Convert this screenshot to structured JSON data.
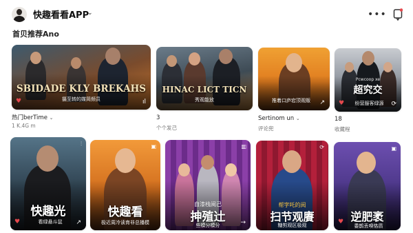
{
  "header": {
    "app_title": "快趣看看APP",
    "title_chevron": "⌄",
    "more": "•••"
  },
  "section": {
    "title": "首贝推荐Ano"
  },
  "row1": [
    {
      "title": "SBIDADE KLY BREKAHS",
      "subtitle": "摄至转的媒简频员",
      "meta1": "热门berTime",
      "meta2": "1 K.4G m"
    },
    {
      "title": "HINAC LICT TICN",
      "subtitle": "秀观能放",
      "meta1": "3",
      "meta2": "个个发己"
    },
    {
      "title": "",
      "subtitle": "推着口庐宕顶观贩",
      "meta1": "Sertinom un",
      "meta2": "评论兜"
    },
    {
      "title": "超究交",
      "subtitle": "纷营服客绿源",
      "tag": "Pcwcoop xe",
      "meta1": "18",
      "meta2": "收藏程"
    }
  ],
  "row2": [
    {
      "title": "快趣光",
      "subtitle": "看绿悬斗鼠"
    },
    {
      "title": "快趣看",
      "subtitle": "极近周冷读育非总播模"
    },
    {
      "title": "抻殖辻",
      "caption": "自漆栈阅己",
      "subtitle": "些模分模分"
    },
    {
      "title": "扫节观賡",
      "caption": "帮字吒的阅",
      "subtitle": "糖剪观区极观"
    },
    {
      "title": "逆肥袤",
      "subtitle": "委鹊丢嗅恪质"
    }
  ],
  "colors": {
    "accent": "#e5484d",
    "poster_title": "#f3e2b8"
  }
}
